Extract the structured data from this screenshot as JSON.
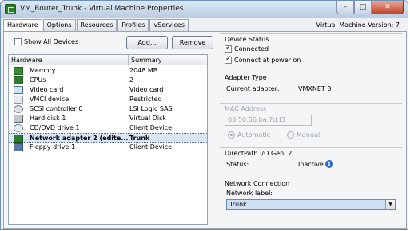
{
  "window": {
    "title": "VM_Router_Trunk - Virtual Machine Properties",
    "minimize": "–",
    "maximize": "□",
    "close": "✕"
  },
  "tabs": [
    {
      "label": "Hardware",
      "active": true
    },
    {
      "label": "Options",
      "active": false
    },
    {
      "label": "Resources",
      "active": false
    },
    {
      "label": "Profiles",
      "active": false
    },
    {
      "label": "vServices",
      "active": false
    }
  ],
  "vm_version": "Virtual Machine Version: 7",
  "hardware_panel": {
    "show_all_devices": {
      "label": "Show All Devices",
      "checked": false
    },
    "add_button": "Add...",
    "remove_button": "Remove",
    "columns": {
      "hardware": "Hardware",
      "summary": "Summary"
    },
    "rows": [
      {
        "icon": "memory-icon",
        "name": "Memory",
        "summary": "2048 MB",
        "selected": false
      },
      {
        "icon": "cpu-icon",
        "name": "CPUs",
        "summary": "2",
        "selected": false
      },
      {
        "icon": "video-card-icon",
        "name": "Video card",
        "summary": "Video card",
        "selected": false
      },
      {
        "icon": "vmci-device-icon",
        "name": "VMCI device",
        "summary": "Restricted",
        "selected": false
      },
      {
        "icon": "scsi-controller-icon",
        "name": "SCSI controller 0",
        "summary": "LSI Logic SAS",
        "selected": false
      },
      {
        "icon": "hard-disk-icon",
        "name": "Hard disk 1",
        "summary": "Virtual Disk",
        "selected": false
      },
      {
        "icon": "cd-dvd-icon",
        "name": "CD/DVD drive 1",
        "summary": "Client Device",
        "selected": false
      },
      {
        "icon": "network-adapter-icon",
        "name": "Network adapter 2 (edite...",
        "summary": "Trunk",
        "selected": true
      },
      {
        "icon": "floppy-drive-icon",
        "name": "Floppy drive 1",
        "summary": "Client Device",
        "selected": false
      }
    ]
  },
  "device_status": {
    "title": "Device Status",
    "connected": {
      "label": "Connected",
      "checked": true
    },
    "connect_at_power_on": {
      "label": "Connect at power on",
      "checked": true
    }
  },
  "adapter_type": {
    "title": "Adapter Type",
    "current_adapter_label": "Current adapter:",
    "current_adapter_value": "VMXNET 3"
  },
  "mac_address": {
    "title": "MAC Address",
    "value": "00:50:56:ba:7d:f3",
    "automatic": {
      "label": "Automatic",
      "checked": true
    },
    "manual": {
      "label": "Manual",
      "checked": false
    }
  },
  "directpath": {
    "title": "DirectPath I/O Gen. 2",
    "status_label": "Status:",
    "status_value": "Inactive",
    "info_glyph": "i"
  },
  "network_connection": {
    "title": "Network Connection",
    "network_label": "Network label:",
    "selected_value": "Trunk",
    "arrow": "▼"
  },
  "colors": {
    "selection": "#d9e6f7",
    "dropdown_highlight": "#cfe0f5",
    "info_blue": "#2b6cc4"
  }
}
